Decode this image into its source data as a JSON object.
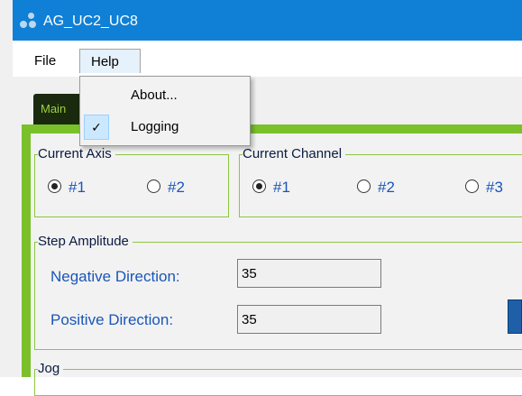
{
  "window": {
    "title": "AG_UC2_UC8"
  },
  "menu": {
    "file_label": "File",
    "help_label": "Help",
    "help_items": [
      {
        "label": "About...",
        "checked": false
      },
      {
        "label": "Logging",
        "checked": true
      }
    ]
  },
  "tab": {
    "label": "Main"
  },
  "current_axis": {
    "title": "Current Axis",
    "options": [
      "#1",
      "#2"
    ],
    "selected": "#1"
  },
  "current_channel": {
    "title": "Current Channel",
    "options": [
      "#1",
      "#2",
      "#3"
    ],
    "selected": "#1"
  },
  "step_amplitude": {
    "title": "Step Amplitude",
    "negative_label": "Negative Direction:",
    "negative_value": "35",
    "positive_label": "Positive Direction:",
    "positive_value": "35"
  },
  "jog": {
    "title": "Jog"
  },
  "colors": {
    "titlebar": "#0f80d6",
    "accent_green": "#7ac02a",
    "label_blue": "#1a56b8"
  }
}
